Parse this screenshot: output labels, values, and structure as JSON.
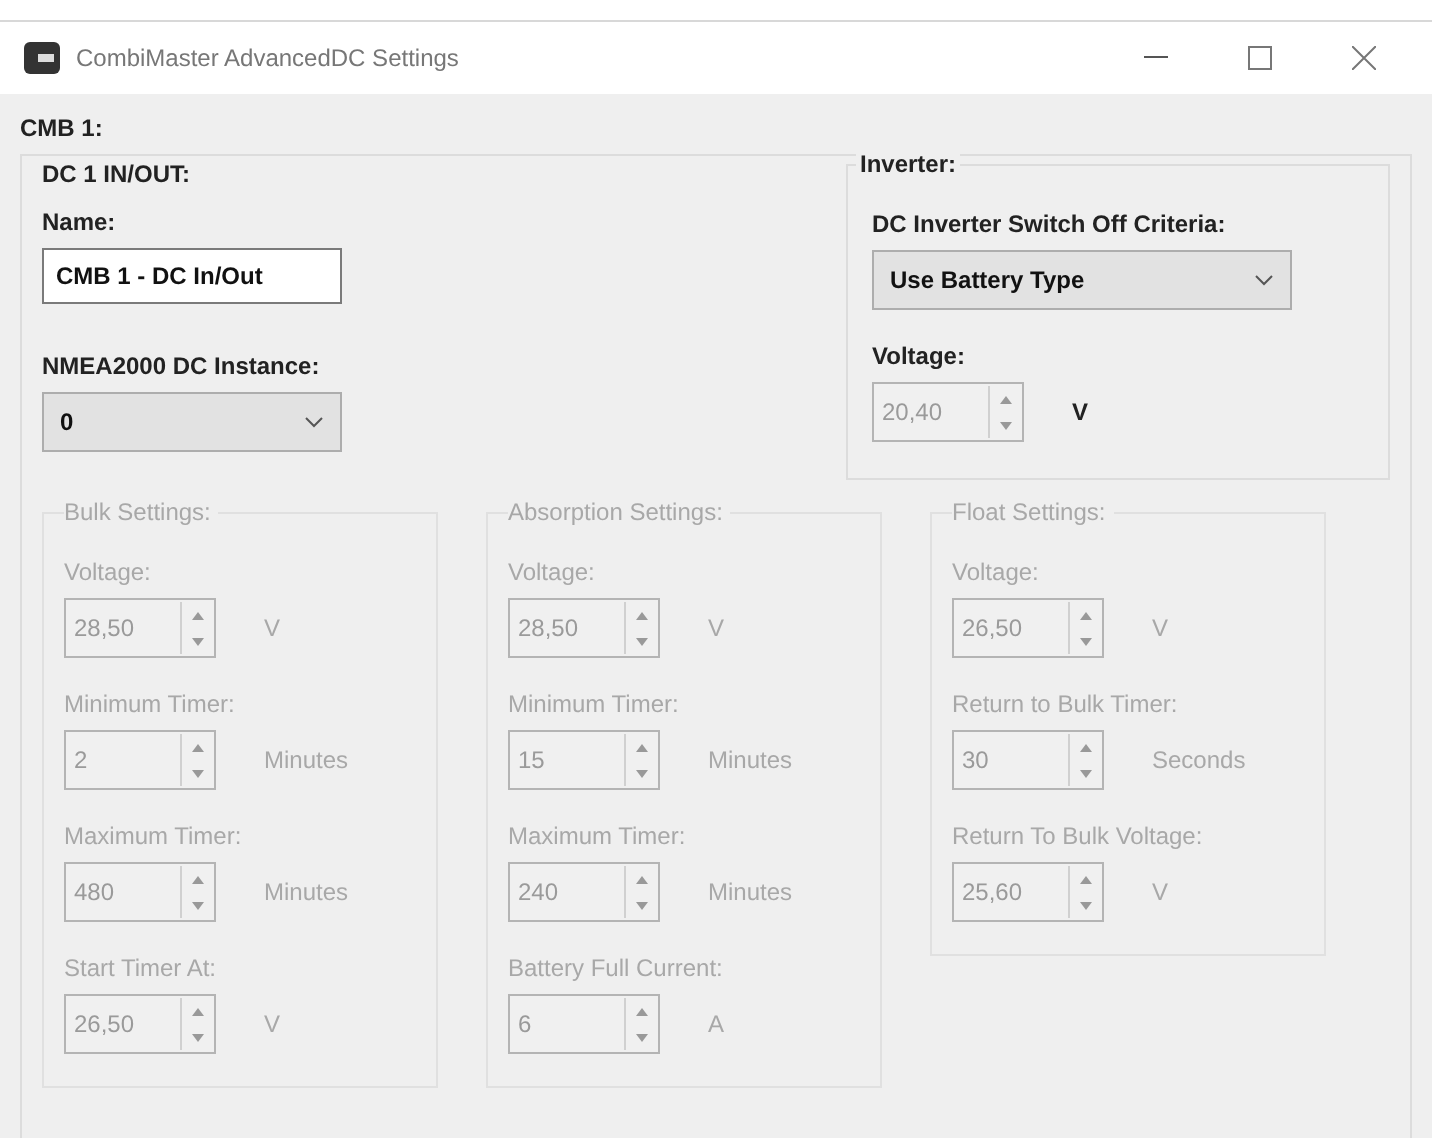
{
  "window": {
    "title": "CombiMaster AdvancedDC Settings"
  },
  "device_label": "CMB 1:",
  "channel": {
    "title": "DC 1 IN/OUT:",
    "name_label": "Name:",
    "name_value": "CMB 1 - DC In/Out",
    "instance_label": "NMEA2000 DC Instance:",
    "instance_value": "0"
  },
  "inverter": {
    "title": "Inverter:",
    "criteria_label": "DC Inverter Switch Off Criteria:",
    "criteria_value": "Use Battery Type",
    "voltage_label": "Voltage:",
    "voltage_value": "20,40",
    "voltage_unit": "V",
    "voltage_disabled": true
  },
  "groups": [
    {
      "title": "Bulk Settings:",
      "disabled": true,
      "fields": [
        {
          "label": "Voltage:",
          "value": "28,50",
          "unit": "V"
        },
        {
          "label": "Minimum Timer:",
          "value": "2",
          "unit": "Minutes"
        },
        {
          "label": "Maximum Timer:",
          "value": "480",
          "unit": "Minutes"
        },
        {
          "label": "Start Timer At:",
          "value": "26,50",
          "unit": "V"
        }
      ]
    },
    {
      "title": "Absorption Settings:",
      "disabled": true,
      "fields": [
        {
          "label": "Voltage:",
          "value": "28,50",
          "unit": "V"
        },
        {
          "label": "Minimum Timer:",
          "value": "15",
          "unit": "Minutes"
        },
        {
          "label": "Maximum Timer:",
          "value": "240",
          "unit": "Minutes"
        },
        {
          "label": "Battery Full Current:",
          "value": "6",
          "unit": "A"
        }
      ]
    },
    {
      "title": "Float Settings:",
      "disabled": true,
      "fields": [
        {
          "label": "Voltage:",
          "value": "26,50",
          "unit": "V"
        },
        {
          "label": "Return to Bulk Timer:",
          "value": "30",
          "unit": "Seconds"
        },
        {
          "label": "Return To Bulk Voltage:",
          "value": "25,60",
          "unit": "V"
        }
      ]
    }
  ]
}
